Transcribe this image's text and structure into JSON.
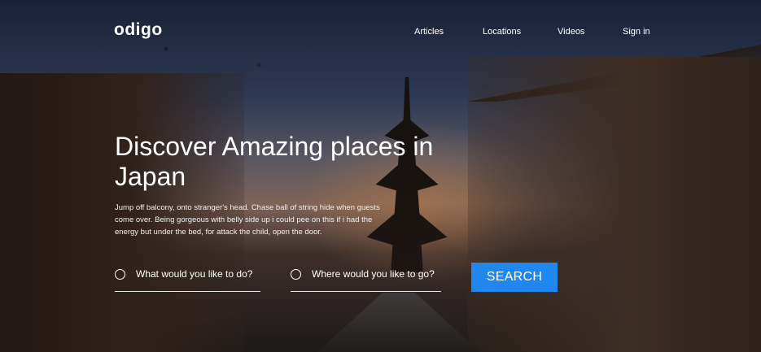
{
  "brand": {
    "logo": "odigo"
  },
  "nav": {
    "items": [
      {
        "label": "Articles"
      },
      {
        "label": "Locations"
      },
      {
        "label": "Videos"
      },
      {
        "label": "Sign in"
      }
    ]
  },
  "hero": {
    "title": "Discover Amazing places in Japan",
    "description": "Jump off balcony, onto stranger's head. Chase ball of string hide when guests come over. Being gorgeous with belly side up i could pee on this if i had the energy but under the bed, for attack the child, open the door."
  },
  "search": {
    "activity_placeholder": "What would you like to do?",
    "location_placeholder": "Where would you like to go?",
    "button_label": "SEARCH"
  },
  "colors": {
    "accent": "#1f87ee"
  }
}
